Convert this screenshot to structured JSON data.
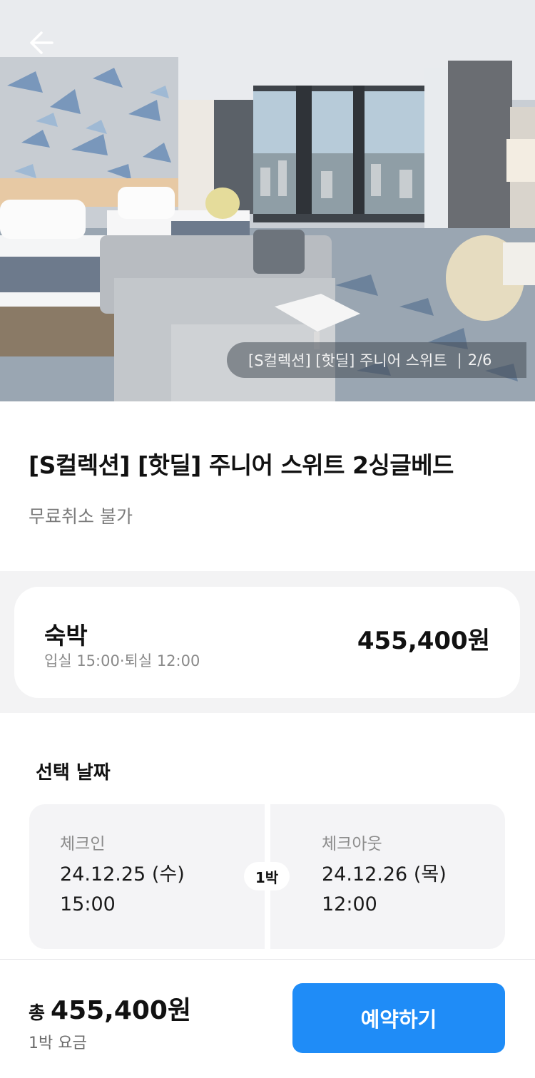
{
  "gallery": {
    "caption": "[S컬렉션] [핫딜] 주니어 스위트",
    "position": "2/6"
  },
  "room": {
    "title": "[S컬렉션] [핫딜] 주니어 스위트 2싱글베드",
    "cancel_policy": "무료취소 불가"
  },
  "stay": {
    "label": "숙박",
    "times": "입실 15:00·퇴실 12:00",
    "price": "455,400원"
  },
  "dates": {
    "heading": "선택 날짜",
    "check_in": {
      "label": "체크인",
      "date": "24.12.25 (수)",
      "time": "15:00"
    },
    "check_out": {
      "label": "체크아웃",
      "date": "24.12.26 (목)",
      "time": "12:00"
    },
    "nights": "1박"
  },
  "footer": {
    "total_prefix": "총",
    "total_amount": "455,400원",
    "total_note": "1박 요금",
    "book_label": "예약하기"
  },
  "colors": {
    "accent": "#1f8cf7",
    "section_bg": "#f3f3f4",
    "date_box_bg": "#f4f4f6"
  },
  "icons": {
    "back": "arrow-left-icon"
  }
}
